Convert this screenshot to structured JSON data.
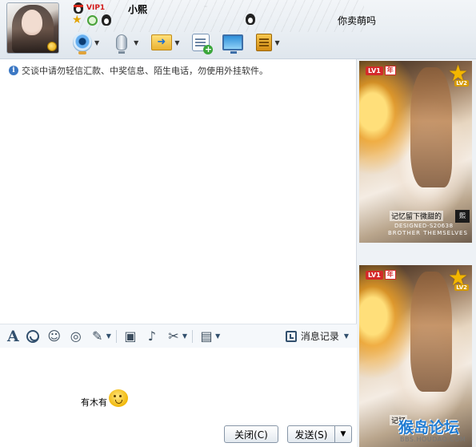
{
  "header": {
    "contact_name": "小熙",
    "vip_label": "VIP1",
    "signature": "你卖萌吗"
  },
  "toolbar": {
    "items": [
      {
        "name": "video-call",
        "icon": "webcam-icon"
      },
      {
        "name": "voice-call",
        "icon": "microphone-icon"
      },
      {
        "name": "send-file",
        "icon": "folder-arrow-icon"
      },
      {
        "name": "create-group-chat",
        "icon": "chat-add-icon"
      },
      {
        "name": "remote-assistance",
        "icon": "monitor-icon"
      },
      {
        "name": "apps",
        "icon": "app-icon"
      }
    ]
  },
  "chat": {
    "notice": "交谈中请勿轻信汇款、中奖信息、陌生电话，勿使用外挂软件。"
  },
  "format_bar": {
    "history_label": "消息记录"
  },
  "input": {
    "text": "有木有"
  },
  "buttons": {
    "close": "关闭(C)",
    "send": "发送(S)",
    "send_dropdown": "▼"
  },
  "panel": {
    "top_photo": {
      "lv_badge": "LV1",
      "year_badge": "年",
      "star_level": "LV2",
      "caption": "记忆留下微甜的",
      "credit": "DESIGNED-S20638",
      "subtitle": "BROTHER THEMSELVES"
    },
    "bottom_photo": {
      "lv_badge": "LV1",
      "year_badge": "年",
      "star_level": "LV2",
      "caption": "记忆"
    }
  },
  "watermark": {
    "text": "猴岛论坛",
    "url": "BBS.HOUDAO.COM"
  },
  "colors": {
    "header_bg": "#e9eef3",
    "accent": "#1f7bd2",
    "vip_red": "#d21b1b"
  }
}
